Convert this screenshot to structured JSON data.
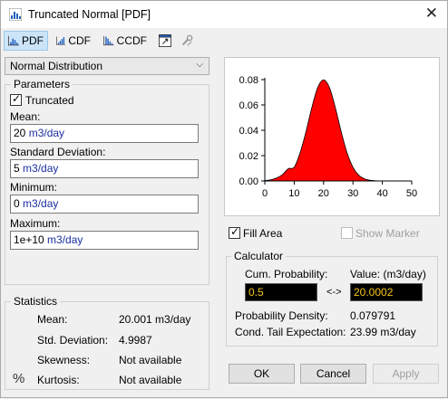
{
  "window": {
    "title": "Truncated Normal [PDF]",
    "close_glyph": "✕"
  },
  "toolbar": {
    "pdf_label": "PDF",
    "cdf_label": "CDF",
    "ccdf_label": "CCDF",
    "active": "PDF"
  },
  "distribution_select": {
    "value": "Normal Distribution"
  },
  "parameters": {
    "legend": "Parameters",
    "truncated_label": "Truncated",
    "truncated_checked": true,
    "mean_label": "Mean:",
    "mean_value": "20",
    "mean_unit": "m3/day",
    "sd_label": "Standard Deviation:",
    "sd_value": "5",
    "sd_unit": "m3/day",
    "min_label": "Minimum:",
    "min_value": "0",
    "min_unit": "m3/day",
    "max_label": "Maximum:",
    "max_value": "1e+10",
    "max_unit": "m3/day"
  },
  "statistics": {
    "legend": "Statistics",
    "percent_glyph": "%",
    "rows": [
      {
        "label": "Mean:",
        "value": "20.001 m3/day"
      },
      {
        "label": "Std. Deviation:",
        "value": "4.9987"
      },
      {
        "label": "Skewness:",
        "value": "Not available"
      },
      {
        "label": "Kurtosis:",
        "value": "Not available"
      }
    ]
  },
  "chart_data": {
    "type": "area",
    "title": "",
    "xlabel": "",
    "ylabel": "",
    "xlim": [
      0,
      50
    ],
    "ylim": [
      0,
      0.08
    ],
    "x_ticks": [
      "0",
      "10",
      "20",
      "30",
      "40",
      "50"
    ],
    "y_ticks": [
      "0.00",
      "0.02",
      "0.04",
      "0.06",
      "0.08"
    ],
    "fill_color": "#ff0000",
    "grid": false,
    "series": [
      {
        "x": [
          0,
          2,
          4,
          6,
          8,
          10,
          12,
          14,
          16,
          18,
          20,
          22,
          24,
          26,
          28,
          30,
          32,
          34,
          36,
          38,
          40
        ],
        "y": [
          0.0003,
          0.0009,
          0.0023,
          0.005,
          0.0097,
          0.0108,
          0.0222,
          0.0388,
          0.0579,
          0.0737,
          0.0798,
          0.0737,
          0.0579,
          0.0388,
          0.0222,
          0.0108,
          0.0045,
          0.0016,
          0.0005,
          0.0001,
          0.0
        ]
      }
    ]
  },
  "options": {
    "fill_area_label": "Fill Area",
    "fill_area_checked": true,
    "show_marker_label": "Show Marker",
    "show_marker_checked": false
  },
  "calculator": {
    "legend": "Calculator",
    "cum_prob_label": "Cum. Probability:",
    "value_label": "Value: (m3/day)",
    "cum_prob_value": "0.5",
    "arrow": "<->",
    "value_value": "20.0002",
    "density_label": "Probability Density:",
    "density_value": "0.079791",
    "tail_label": "Cond. Tail Expectation:",
    "tail_value": "23.99 m3/day"
  },
  "buttons": {
    "ok": "OK",
    "cancel": "Cancel",
    "apply": "Apply"
  },
  "colors": {
    "accent": "#cce4f7",
    "unit_text": "#1a2fa0",
    "calc_text": "#f5c518"
  }
}
